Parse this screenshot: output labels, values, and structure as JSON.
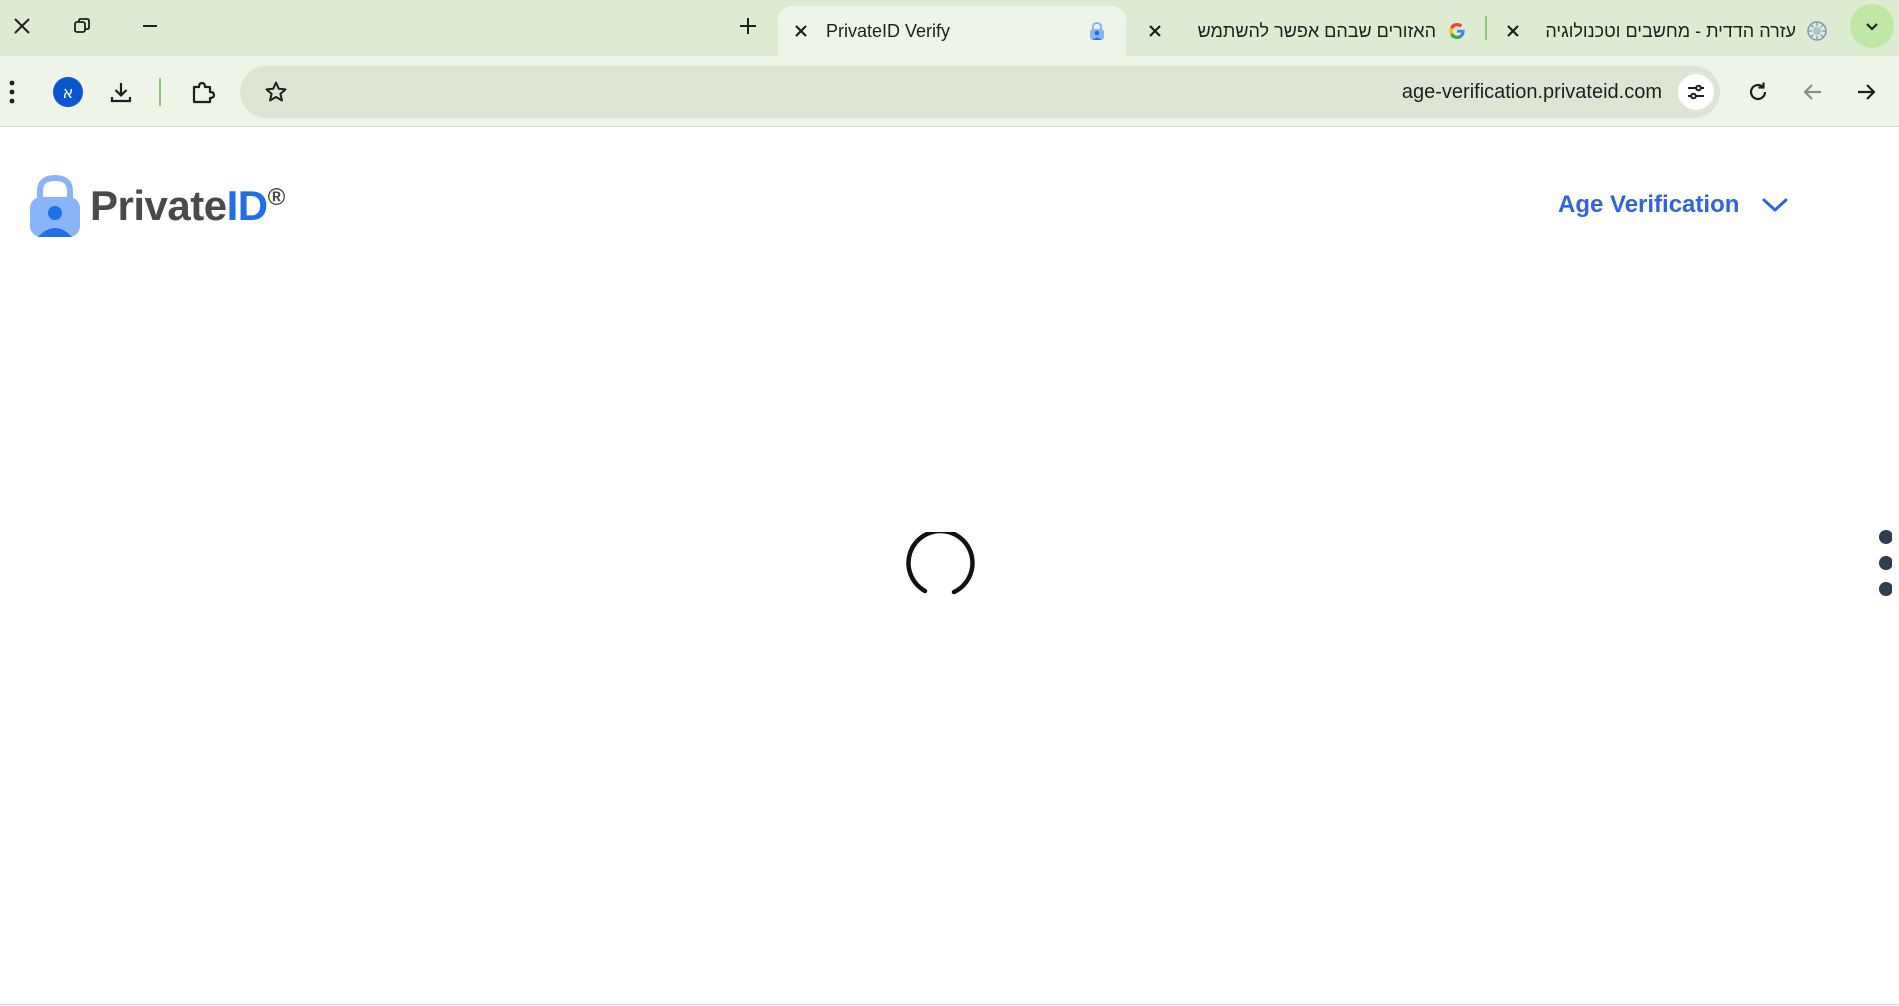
{
  "browser": {
    "tabs": [
      {
        "title": "PrivateID Verify",
        "active": true,
        "favicon": "privateid-lock-icon"
      },
      {
        "title": "האזורים שבהם אפשר להשתמש",
        "active": false,
        "favicon": "google-g-icon"
      },
      {
        "title": "עזרה הדדית - מחשבים וטכנולוגיה",
        "active": false,
        "favicon": "site-emblem-icon"
      }
    ],
    "address_bar": {
      "url": "age-verification.privateid.com"
    },
    "profile_initial": "א"
  },
  "page": {
    "logo": {
      "text_main": "Private",
      "text_accent": "ID",
      "text_reg": "®"
    },
    "nav": {
      "label": "Age Verification"
    },
    "status": "loading"
  },
  "colors": {
    "tab_strip": "#dcebd2",
    "toolbar": "#eef4e8",
    "omnibox": "#dde6d5",
    "brand_blue": "#1e6fe8",
    "nav_blue": "#2f63e0",
    "logo_gray": "#4a4a4a"
  }
}
